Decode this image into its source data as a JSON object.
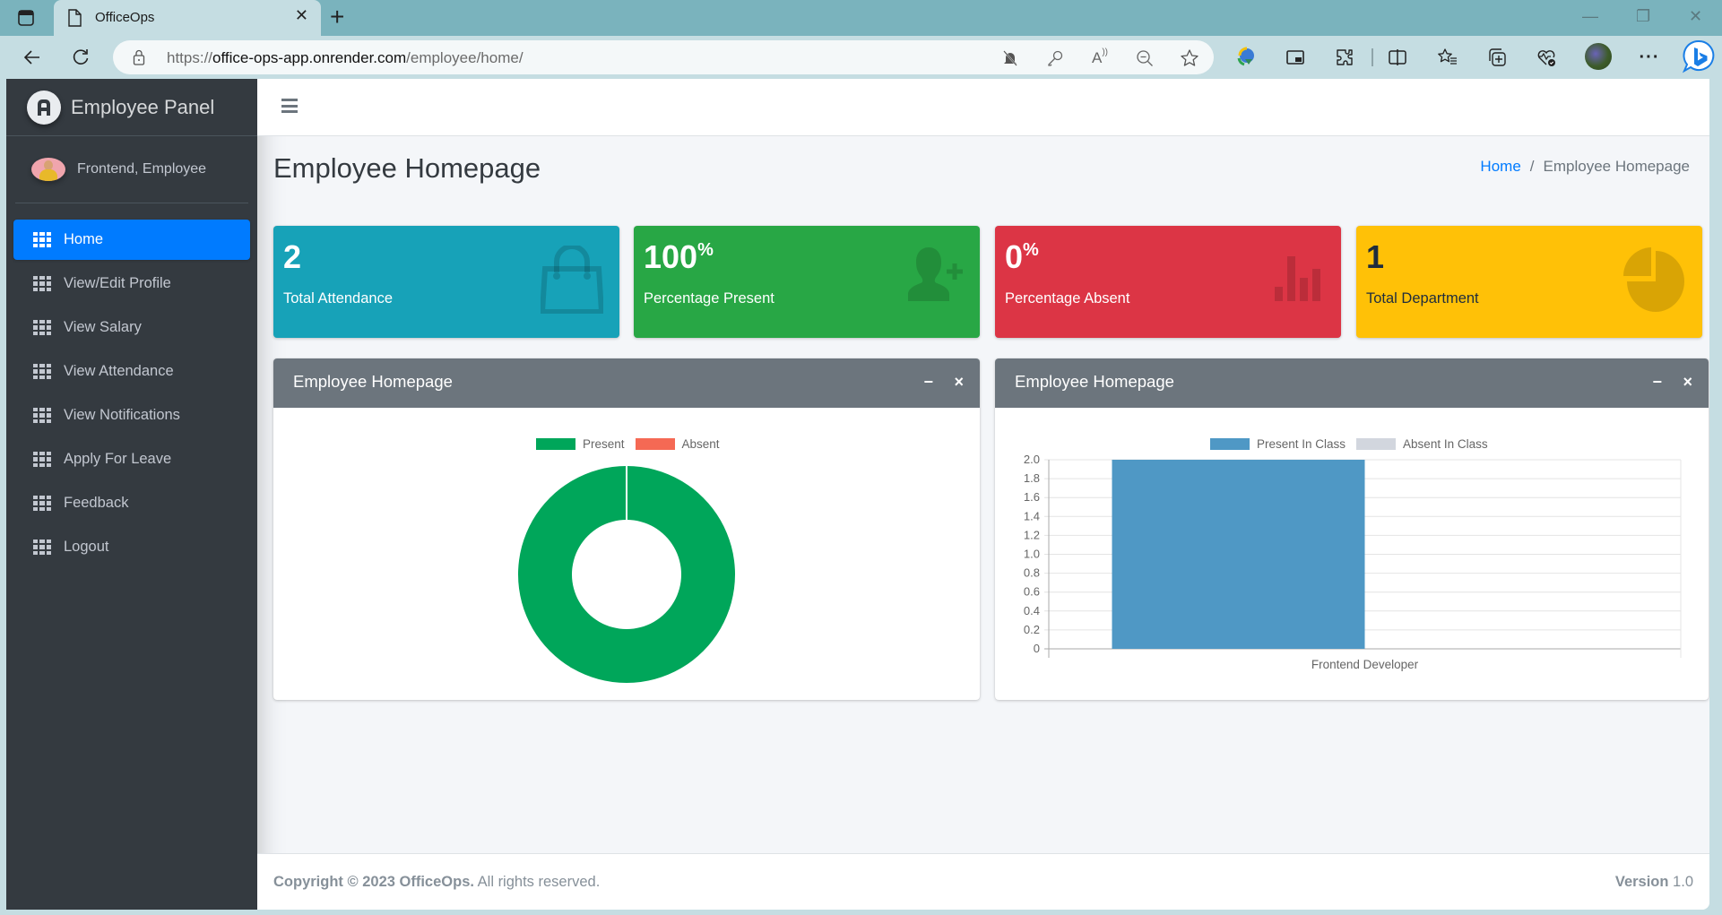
{
  "browser": {
    "tab_title": "OfficeOps",
    "url_prefix": "https://",
    "url_host": "office-ops-app.onrender.com",
    "url_path": "/employee/home/",
    "icons": [
      "tab-actions-icon",
      "page-icon",
      "close-tab-icon",
      "new-tab-icon",
      "back-icon",
      "refresh-icon",
      "lock-icon",
      "notifications-blocked-icon",
      "password-key-icon",
      "read-aloud-icon",
      "zoom-out-icon",
      "favorite-star-icon",
      "download-manager-icon",
      "picture-in-picture-icon",
      "extensions-icon",
      "split-screen-icon",
      "favorites-icon",
      "collections-icon",
      "browser-essentials-icon",
      "profile-avatar",
      "more-menu-icon",
      "bing-copilot-icon",
      "minimize-icon",
      "restore-icon",
      "close-window-icon"
    ]
  },
  "sidebar": {
    "brand": "Employee Panel",
    "user_name": "Frontend, Employee",
    "items": [
      {
        "label": "Home",
        "active": true
      },
      {
        "label": "View/Edit Profile",
        "active": false
      },
      {
        "label": "View Salary",
        "active": false
      },
      {
        "label": "View Attendance",
        "active": false
      },
      {
        "label": "View Notifications",
        "active": false
      },
      {
        "label": "Apply For Leave",
        "active": false
      },
      {
        "label": "Feedback",
        "active": false
      },
      {
        "label": "Logout",
        "active": false
      }
    ]
  },
  "header": {
    "page_title": "Employee Homepage",
    "breadcrumb": {
      "home": "Home",
      "separator": "/",
      "current": "Employee Homepage"
    }
  },
  "stats": [
    {
      "value": "2",
      "suffix": "",
      "label": "Total Attendance",
      "color": "#17a2b8",
      "icon": "shopping-bag-icon"
    },
    {
      "value": "100",
      "suffix": "%",
      "label": "Percentage Present",
      "color": "#28a745",
      "icon": "user-plus-icon"
    },
    {
      "value": "0",
      "suffix": "%",
      "label": "Percentage Absent",
      "color": "#dc3545",
      "icon": "bar-chart-icon"
    },
    {
      "value": "1",
      "suffix": "",
      "label": "Total Department",
      "color": "#ffc107",
      "icon": "pie-chart-icon"
    }
  ],
  "cards": [
    {
      "title": "Employee Homepage",
      "minimize": "−",
      "close": "×"
    },
    {
      "title": "Employee Homepage",
      "minimize": "−",
      "close": "×"
    }
  ],
  "chart_data": [
    {
      "type": "pie",
      "variant": "doughnut",
      "title": "",
      "labels": [
        "Present",
        "Absent"
      ],
      "values": [
        2,
        0
      ],
      "colors": [
        "#00a65a",
        "#f56954"
      ],
      "legend": "top"
    },
    {
      "type": "bar",
      "title": "",
      "categories": [
        "Frontend Developer"
      ],
      "series": [
        {
          "name": "Present In Class",
          "values": [
            2
          ],
          "color": "#4f98c5"
        },
        {
          "name": "Absent In Class",
          "values": [
            0
          ],
          "color": "#d2d6de"
        }
      ],
      "xlabel": "",
      "ylabel": "",
      "ylim": [
        0,
        2.0
      ],
      "yticks": [
        "0",
        "0.2",
        "0.4",
        "0.6",
        "0.8",
        "1.0",
        "1.2",
        "1.4",
        "1.6",
        "1.8",
        "2.0"
      ],
      "grid": true,
      "legend": "top"
    }
  ],
  "footer": {
    "copyright_bold": "Copyright © 2023 OfficeOps.",
    "copyright_rest": " All rights reserved.",
    "version_label": "Version",
    "version_value": " 1.0"
  }
}
